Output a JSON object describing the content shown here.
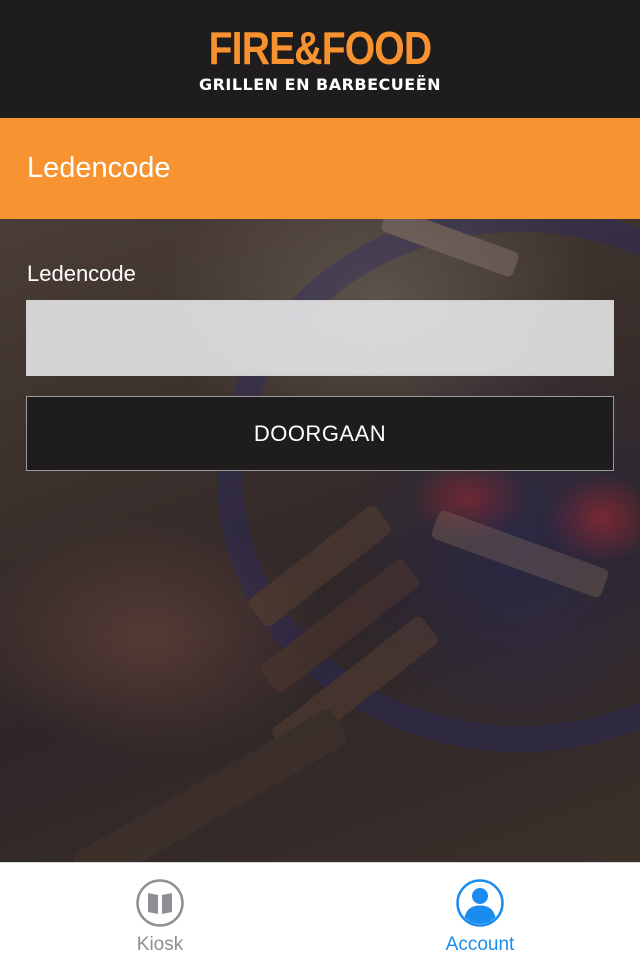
{
  "brand": {
    "name": "FIRE&FOOD",
    "tagline": "GRILLEN EN BARBECUEËN",
    "accent_color": "#f79431"
  },
  "page": {
    "title": "Ledencode"
  },
  "form": {
    "field_label": "Ledencode",
    "input_value": "",
    "input_placeholder": "",
    "submit_label": "DOORGAAN"
  },
  "tabbar": {
    "active_color": "#1a8cf0",
    "inactive_color": "#8e8e93",
    "tabs": [
      {
        "label": "Kiosk",
        "icon": "book-icon",
        "active": false
      },
      {
        "label": "Account",
        "icon": "account-icon",
        "active": true
      }
    ]
  }
}
